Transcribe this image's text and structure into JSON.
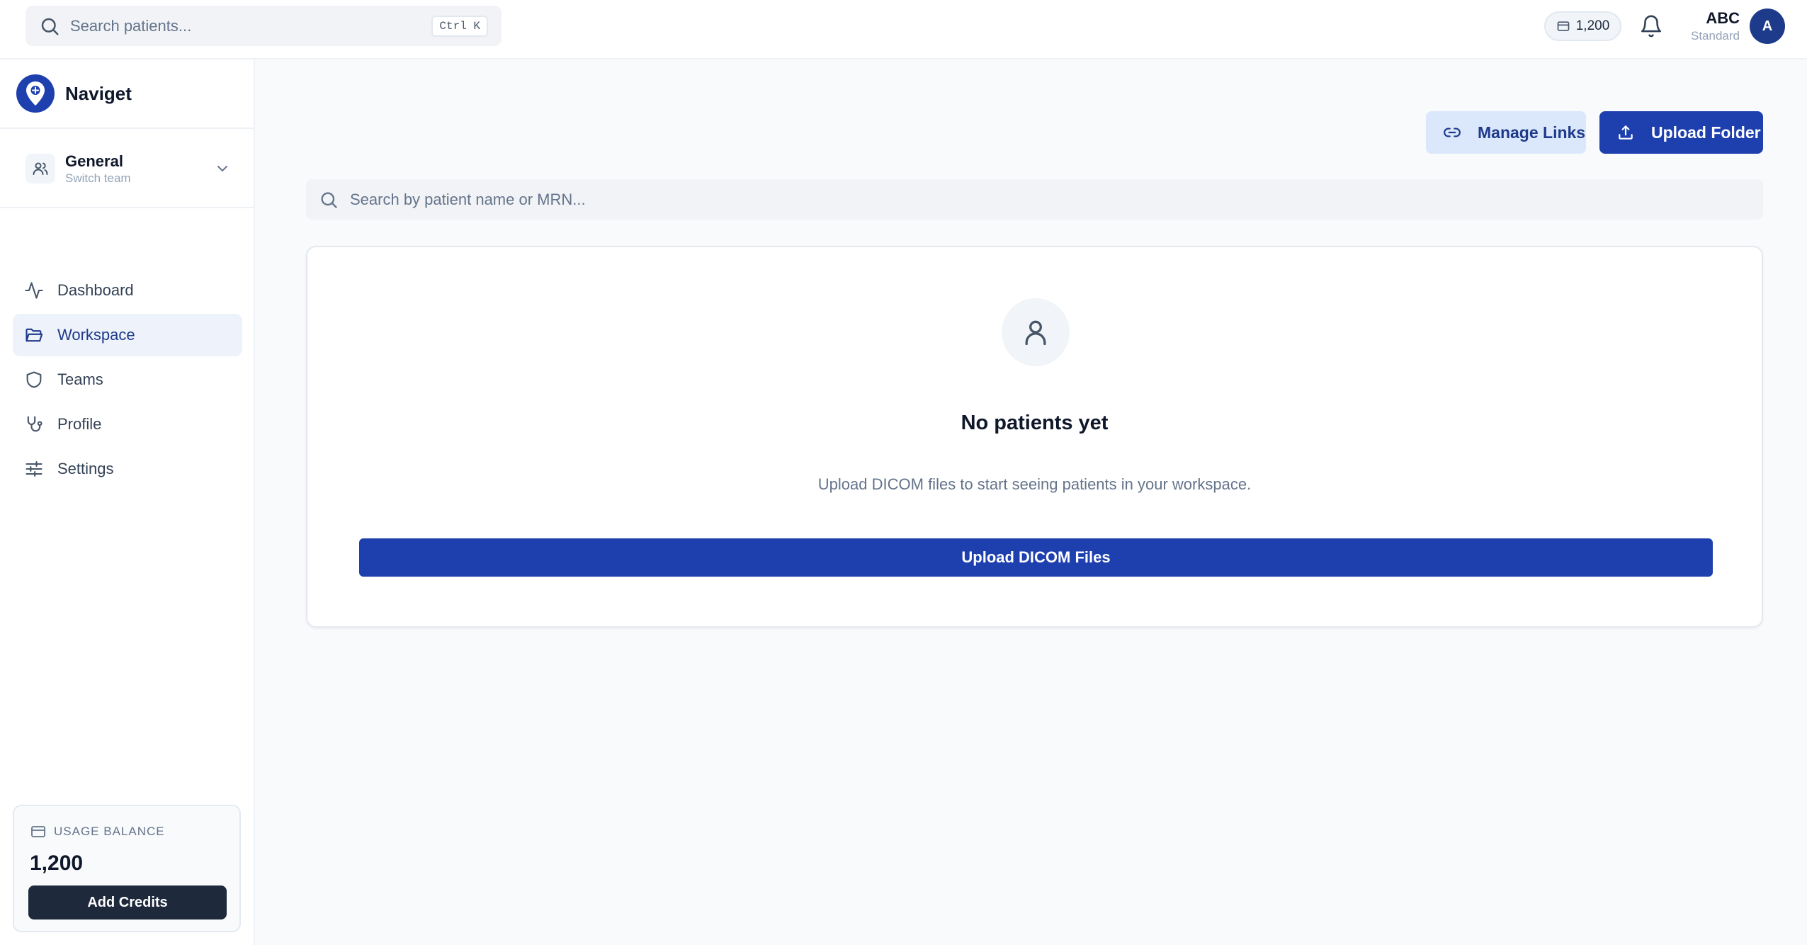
{
  "topbar": {
    "search_placeholder": "Search patients...",
    "shortcut": "Ctrl K",
    "credits": "1,200",
    "user_name": "ABC",
    "user_plan": "Standard",
    "avatar_initial": "A"
  },
  "sidebar": {
    "brand_name": "Naviget",
    "team": {
      "name": "General",
      "subtitle": "Switch team"
    },
    "nav": [
      {
        "label": "Dashboard",
        "icon": "activity-icon",
        "active": false
      },
      {
        "label": "Workspace",
        "icon": "folder-open-icon",
        "active": true
      },
      {
        "label": "Teams",
        "icon": "shield-icon",
        "active": false
      },
      {
        "label": "Profile",
        "icon": "stethoscope-icon",
        "active": false
      },
      {
        "label": "Settings",
        "icon": "sliders-icon",
        "active": false
      }
    ],
    "usage": {
      "title": "USAGE BALANCE",
      "value": "1,200",
      "button": "Add Credits"
    }
  },
  "main": {
    "manage_links": "Manage Links",
    "upload_folder": "Upload Folder",
    "search_placeholder": "Search by patient name or MRN...",
    "empty": {
      "title": "No patients yet",
      "description": "Upload DICOM files to start seeing patients in your workspace.",
      "button": "Upload DICOM Files"
    }
  },
  "colors": {
    "primary": "#1e40af",
    "primary_dark": "#1e3a8a",
    "secondary_button_bg": "#dbe7fb",
    "active_nav_bg": "#eef2fb",
    "dark_button": "#1e293b",
    "page_bg": "#f8fafc"
  }
}
